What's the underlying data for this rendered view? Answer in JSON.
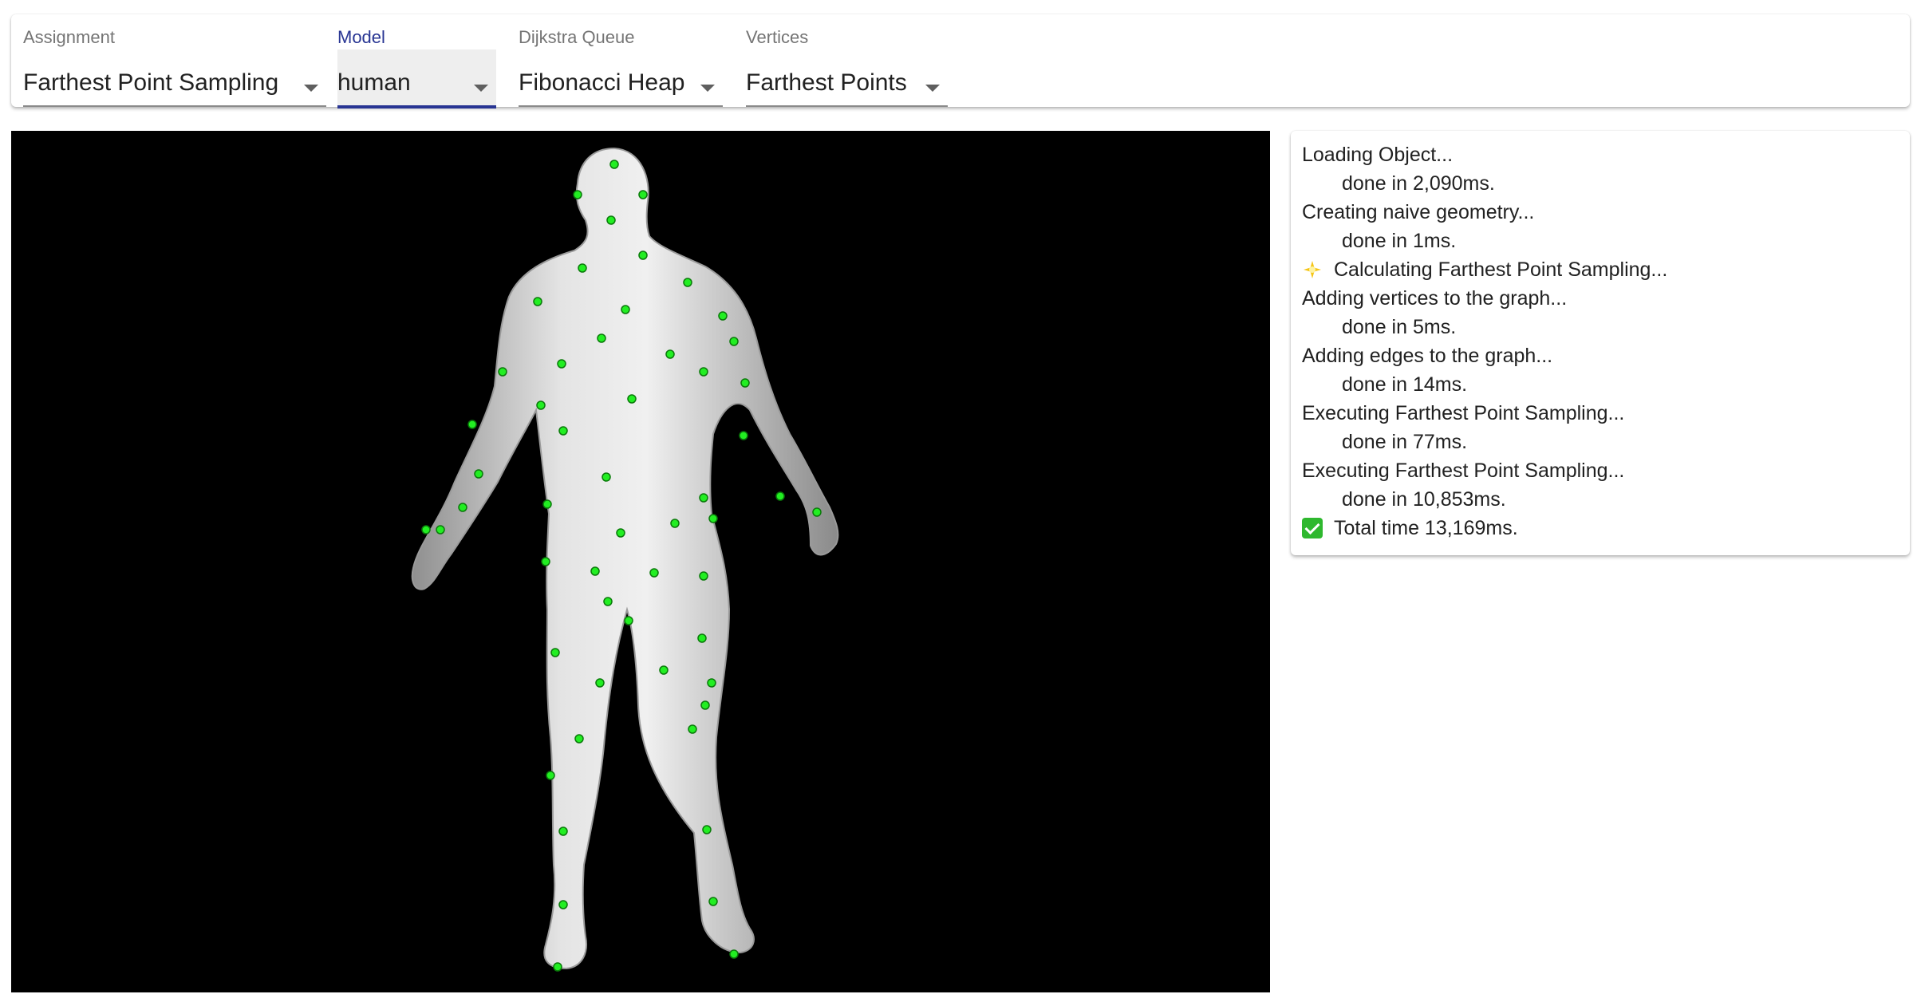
{
  "toolbar": {
    "assignment": {
      "label": "Assignment",
      "value": "Farthest Point Sampling"
    },
    "model": {
      "label": "Model",
      "value": "human"
    },
    "queue": {
      "label": "Dijkstra Queue",
      "value": "Fibonacci Heap"
    },
    "vertices": {
      "label": "Vertices",
      "value": "Farthest Points"
    }
  },
  "viewer": {
    "background": "#000000",
    "mesh_color": "#c8c8c8",
    "point_color": "#22ee22"
  },
  "log": [
    {
      "text": "Loading Object...",
      "indent": false,
      "icon": null
    },
    {
      "text": "done in 2,090ms.",
      "indent": true,
      "icon": null
    },
    {
      "text": "Creating naive geometry...",
      "indent": false,
      "icon": null
    },
    {
      "text": "done in 1ms.",
      "indent": true,
      "icon": null
    },
    {
      "text": "Calculating Farthest Point Sampling...",
      "indent": false,
      "icon": "sparkle-icon"
    },
    {
      "text": "Adding vertices to the graph...",
      "indent": false,
      "icon": null
    },
    {
      "text": "done in 5ms.",
      "indent": true,
      "icon": null
    },
    {
      "text": "Adding edges to the graph...",
      "indent": false,
      "icon": null
    },
    {
      "text": "done in 14ms.",
      "indent": true,
      "icon": null
    },
    {
      "text": "Executing Farthest Point Sampling...",
      "indent": false,
      "icon": null
    },
    {
      "text": "done in 77ms.",
      "indent": true,
      "icon": null
    },
    {
      "text": "Executing Farthest Point Sampling...",
      "indent": false,
      "icon": null
    },
    {
      "text": "done in 10,853ms.",
      "indent": true,
      "icon": null
    },
    {
      "text": "Total time 13,169ms.",
      "indent": false,
      "icon": "check-icon"
    }
  ]
}
